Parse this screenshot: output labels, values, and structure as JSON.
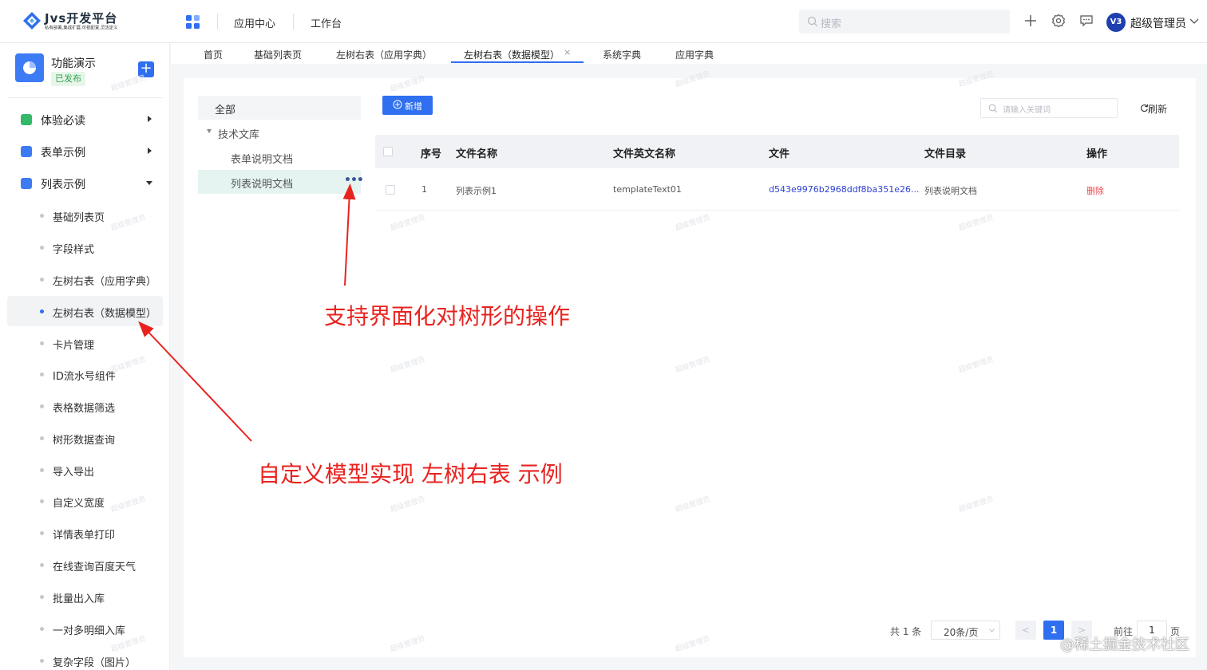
{
  "brand": {
    "title": "Jvs开发平台",
    "subtitle": "私有部署,集成扩展,可视配置,灵活定义"
  },
  "header": {
    "nav": [
      "应用中心",
      "工作台"
    ],
    "search_placeholder": "搜索",
    "avatar_text": "V3",
    "user_name": "超级管理员",
    "icons": [
      "apps-grid-icon",
      "plus-icon",
      "gear-icon",
      "message-icon",
      "chevron-down-icon"
    ]
  },
  "sidebar": {
    "app_name": "功能演示",
    "app_status": "已发布",
    "add_label": "+",
    "groups": [
      {
        "label": "体验必读",
        "color": "#34b86a",
        "expanded": false
      },
      {
        "label": "表单示例",
        "color": "#3d7bf5",
        "expanded": false
      },
      {
        "label": "列表示例",
        "color": "#3d7bf5",
        "expanded": true
      }
    ],
    "items": [
      "基础列表页",
      "字段样式",
      "左树右表（应用字典）",
      "左树右表（数据模型）",
      "卡片管理",
      "ID流水号组件",
      "表格数据筛选",
      "树形数据查询",
      "导入导出",
      "自定义宽度",
      "详情表单打印",
      "在线查询百度天气",
      "批量出入库",
      "一对多明细入库",
      "复杂字段（图片）"
    ],
    "active_item": "左树右表（数据模型）"
  },
  "tabs": {
    "items": [
      "首页",
      "基础列表页",
      "左树右表（应用字典）",
      "左树右表（数据模型）",
      "系统字典",
      "应用字典"
    ],
    "active": "左树右表（数据模型）",
    "close_label": "×"
  },
  "tree": {
    "all_label": "全部",
    "root_label": "技术文库",
    "children": [
      "表单说明文档",
      "列表说明文档"
    ],
    "selected": "列表说明文档",
    "more_label": "•••"
  },
  "toolbar": {
    "add_label": "新增",
    "keyword_placeholder": "请输入关键词",
    "refresh_label": "刷新"
  },
  "table": {
    "columns": [
      "序号",
      "文件名称",
      "文件英文名称",
      "文件",
      "文件目录",
      "操作"
    ],
    "rows": [
      {
        "index": "1",
        "name": "列表示例1",
        "en_name": "templateText01",
        "file": "d543e9976b2968ddf8ba351e26...",
        "dir": "列表说明文档",
        "action": "删除"
      }
    ]
  },
  "pagination": {
    "total_text": "共 1 条",
    "page_size": "20条/页",
    "prev": "<",
    "current": "1",
    "next": ">",
    "goto_label": "前往",
    "goto_value": "1",
    "page_suffix": "页"
  },
  "watermark": "超级管理员",
  "annotations": {
    "tree_ops": "支持界面化对树形的操作",
    "custom_model": "自定义模型实现 左树右表 示例",
    "arrow_color": "#e8231f"
  },
  "credit": "@稀土掘金技术社区",
  "colors": {
    "primary": "#2f6ff0",
    "danger": "#f0454d",
    "link": "#2b3fd1",
    "success": "#33a34e",
    "tree_selected_bg": "#e6f4f1"
  }
}
